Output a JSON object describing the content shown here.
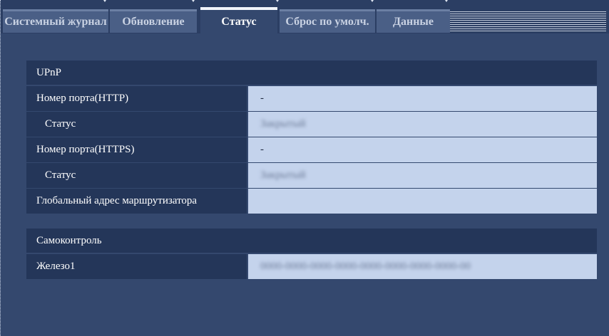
{
  "tabs": [
    {
      "label": "Системный журнал",
      "active": false
    },
    {
      "label": "Обновление",
      "active": false
    },
    {
      "label": "Статус",
      "active": true
    },
    {
      "label": "Сброс по умолч.",
      "active": false
    },
    {
      "label": "Данные",
      "active": false
    }
  ],
  "upnp": {
    "title": "UPnP",
    "rows": [
      {
        "label": "Номер порта(HTTP)",
        "value": "-"
      },
      {
        "label": "Статус",
        "value": "Закрытый"
      },
      {
        "label": "Номер порта(HTTPS)",
        "value": "-"
      },
      {
        "label": "Статус",
        "value": "Закрытый"
      },
      {
        "label": "Глобальный адрес маршрутизатора",
        "value": ""
      }
    ]
  },
  "selfcheck": {
    "title": "Самоконтроль",
    "rows": [
      {
        "label": "Железо1",
        "value": "0000-0000-0000-0000-0000-0000-0000-0000-00"
      }
    ]
  },
  "colors": {
    "page_bg": "#34486e",
    "header_bg": "#243659",
    "value_bg": "#c4d3ec"
  }
}
